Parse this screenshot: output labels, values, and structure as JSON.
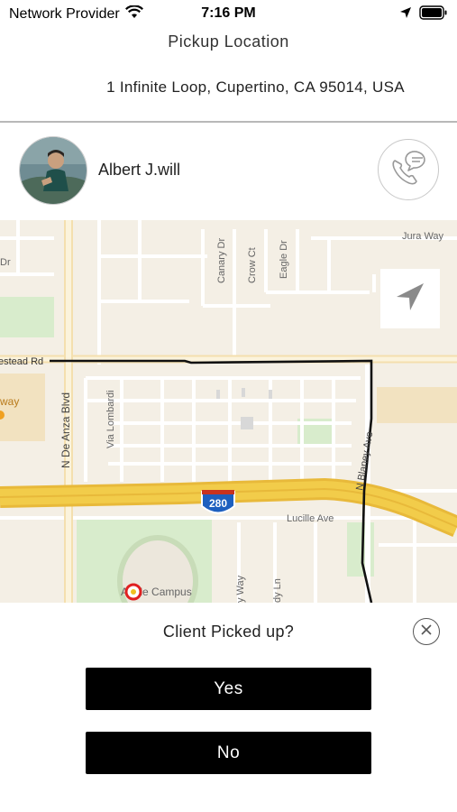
{
  "status_bar": {
    "carrier": "Network Provider",
    "time": "7:16 PM",
    "icons": [
      "wifi-icon",
      "location-arrow-icon",
      "battery-icon"
    ]
  },
  "header": {
    "title": "Pickup Location",
    "address": "1 Infinite Loop, Cupertino, CA 95014, USA"
  },
  "driver": {
    "name": "Albert J.will",
    "call_icon": "phone-chat-icon"
  },
  "map": {
    "labels": {
      "homestead_rd": "estead Rd",
      "jura_way": "Jura Way",
      "dr_left": "Dr",
      "canary_dr": "Canary Dr",
      "crow_ct": "Crow Ct",
      "eagle_dr": "Eagle Dr",
      "way_left": "way",
      "n_de_anza": "N De Anza Blvd",
      "via_lombardi": "Via Lombardi",
      "n_blaney": "N Blaney Ave",
      "highway": "280",
      "lucille_ave": "Lucille Ave",
      "campus": "Apple Campus",
      "y_way": "y Way",
      "dy_ln": "dy Ln"
    },
    "locate_icon": "navigation-arrow-icon",
    "colors": {
      "background": "#f4efe5",
      "highway": "#f2cc4a",
      "route": "#111111",
      "park": "#d8eccc"
    }
  },
  "panel": {
    "question": "Client Picked up?",
    "yes_label": "Yes",
    "no_label": "No",
    "close_icon": "close-circle-icon"
  }
}
